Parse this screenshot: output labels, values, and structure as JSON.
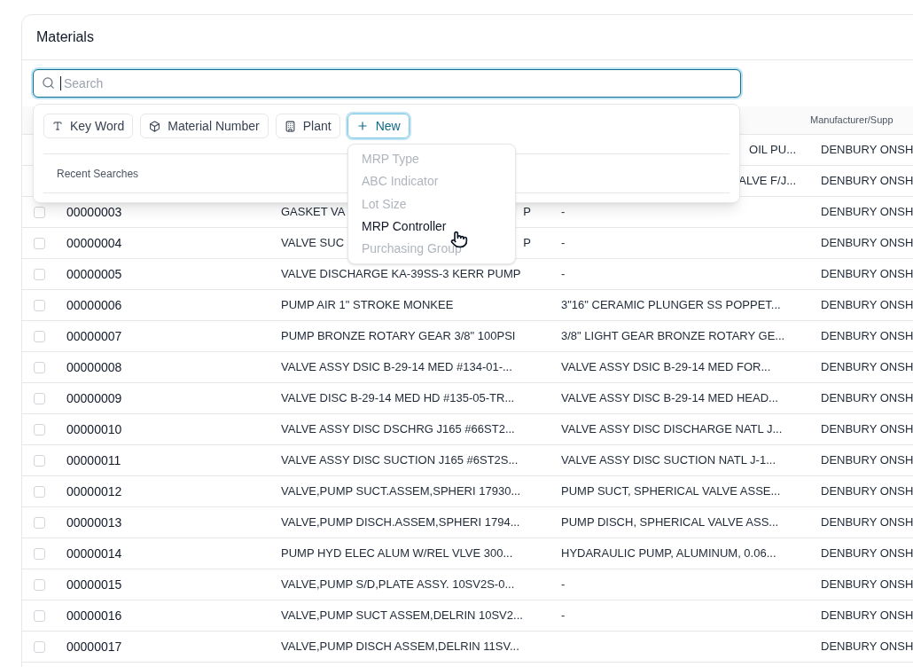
{
  "panel": {
    "title": "Materials"
  },
  "search": {
    "placeholder": "Search"
  },
  "filter_popup": {
    "chips": [
      {
        "kind": "keyword",
        "label": "Key Word",
        "focused": false
      },
      {
        "kind": "cube",
        "label": "Material Number",
        "focused": false
      },
      {
        "kind": "building",
        "label": "Plant",
        "focused": false
      },
      {
        "kind": "add",
        "label": "New",
        "focused": true
      }
    ],
    "recent_label": "Recent Searches"
  },
  "new_menu": {
    "items": [
      {
        "label": "MRP Type",
        "disabled": true
      },
      {
        "label": "ABC Indicator",
        "disabled": true
      },
      {
        "label": "Lot Size",
        "disabled": true
      },
      {
        "label": "MRP Controller",
        "disabled": false
      },
      {
        "label": "Purchasing Group",
        "disabled": true
      }
    ]
  },
  "table": {
    "columns": [
      {
        "label": "Manufacturer/Supp"
      }
    ],
    "rows": [
      {
        "column_3": "OIL PU...",
        "manufacturer": "DENBURY ONSH"
      },
      {
        "column_3": "ALVE F/J...",
        "manufacturer": "DENBURY ONSH"
      },
      {
        "checked": false,
        "id": "00000003",
        "description": [
          "GASKET VA",
          "P"
        ],
        "column_3": "-",
        "manufacturer": "DENBURY ONSH"
      },
      {
        "checked": false,
        "id": "00000004",
        "description": [
          "VALVE SUC",
          "P"
        ],
        "column_3": "-",
        "manufacturer": "DENBURY ONSH"
      },
      {
        "checked": false,
        "id": "00000005",
        "description": [
          "VALVE DISCHARGE KA-39SS-3 KERR PUMP"
        ],
        "column_3": "-",
        "manufacturer": "DENBURY ONSH"
      },
      {
        "checked": false,
        "id": "00000006",
        "description": [
          "PUMP AIR 1\" STROKE MONKEE"
        ],
        "column_3": "3\"16\" CERAMIC PLUNGER SS POPPET...",
        "manufacturer": "DENBURY ONSH"
      },
      {
        "checked": false,
        "id": "00000007",
        "description": [
          "PUMP BRONZE ROTARY GEAR 3/8\" 100PSI"
        ],
        "column_3": "3/8\" LIGHT GEAR BRONZE ROTARY GE...",
        "manufacturer": "DENBURY ONSH"
      },
      {
        "checked": false,
        "id": "00000008",
        "description": [
          "VALVE ASSY DSIC B-29-14 MED #134-01-..."
        ],
        "column_3": "VALVE ASSY DSIC B-29-14 MED FOR...",
        "manufacturer": "DENBURY ONSH"
      },
      {
        "checked": false,
        "id": "00000009",
        "description": [
          "VALVE DISC B-29-14 MED HD #135-05-TR..."
        ],
        "column_3": "VALVE ASSY DISC B-29-14 MED HEAD...",
        "manufacturer": "DENBURY ONSH"
      },
      {
        "checked": false,
        "id": "00000010",
        "description": [
          "VALVE ASSY DISC DSCHRG J165 #66ST2..."
        ],
        "column_3": "VALVE ASSY DISC DISCHARGE NATL J...",
        "manufacturer": "DENBURY ONSH"
      },
      {
        "checked": false,
        "id": "00000011",
        "description": [
          "VALVE ASSY DISC SUCTION J165 #6ST2S..."
        ],
        "column_3": "VALVE ASSY DISC SUCTION NATL J-1...",
        "manufacturer": "DENBURY ONSH"
      },
      {
        "checked": false,
        "id": "00000012",
        "description": [
          "VALVE,PUMP SUCT.ASSEM,SPHERI 17930..."
        ],
        "column_3": "PUMP SUCT, SPHERICAL VALVE ASSE...",
        "manufacturer": "DENBURY ONSH"
      },
      {
        "checked": false,
        "id": "00000013",
        "description": [
          "VALVE,PUMP DISCH.ASSEM,SPHERI 1794..."
        ],
        "column_3": "PUMP DISCH, SPHERICAL VALVE ASS...",
        "manufacturer": "DENBURY ONSH"
      },
      {
        "checked": false,
        "id": "00000014",
        "description": [
          "PUMP HYD ELEC ALUM W/REL VLVE 300..."
        ],
        "column_3": "HYDARAULIC PUMP, ALUMINUM, 0.06...",
        "manufacturer": "DENBURY ONSH"
      },
      {
        "checked": false,
        "id": "00000015",
        "description": [
          "VALVE,PUMP S/D,PLATE ASSY. 10SV2S-0..."
        ],
        "column_3": "-",
        "manufacturer": "DENBURY ONSH"
      },
      {
        "checked": false,
        "id": "00000016",
        "description": [
          "VALVE,PUMP SUCT ASSEM,DELRIN 10SV2..."
        ],
        "column_3": "-",
        "manufacturer": "DENBURY ONSH"
      },
      {
        "checked": false,
        "id": "00000017",
        "description": [
          "VALVE,PUMP DISCH ASSEM,DELRIN 11SV..."
        ],
        "manufacturer": "DENBURY ONSH"
      }
    ]
  }
}
